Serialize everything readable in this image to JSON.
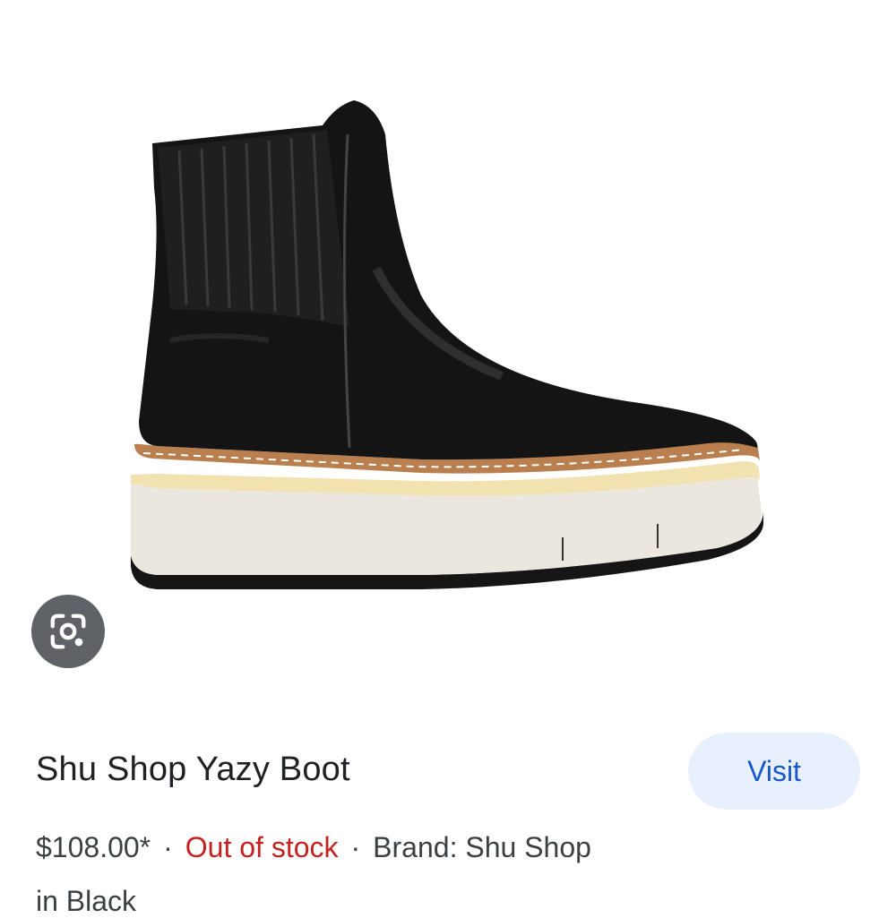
{
  "product": {
    "title": "Shu Shop Yazy Boot",
    "price": "$108.00*",
    "separator": "·",
    "stock_status": "Out of stock",
    "brand": "Brand: Shu Shop",
    "partial_line": "in Black"
  },
  "actions": {
    "visit_label": "Visit"
  },
  "icons": {
    "lens": "google-lens-icon"
  },
  "colors": {
    "visit_bg": "#e8f0fe",
    "visit_text": "#1a57c6",
    "stock_text": "#c5221f",
    "lens_bg": "#5f6368"
  }
}
